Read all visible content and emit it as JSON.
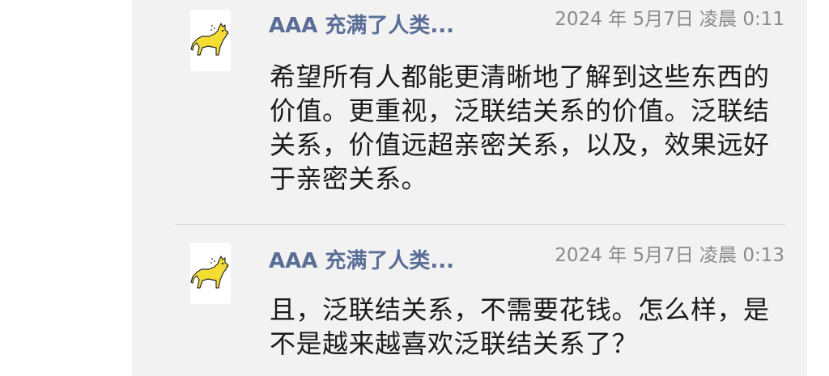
{
  "comments": [
    {
      "author": "AAA 充满了人类...",
      "time": "2024 年 5月7日 凌晨 0:11",
      "text": "希望所有人都能更清晰地了解到这些东西的价值。更重视，泛联结关系的价值。泛联结关系，价值远超亲密关系，以及，效果远好于亲密关系。",
      "avatar_icon": "yellow-cat-icon"
    },
    {
      "author": "AAA 充满了人类...",
      "time": "2024 年 5月7日 凌晨 0:13",
      "text": "且，泛联结关系，不需要花钱。怎么样，是不是越来越喜欢泛联结关系了？",
      "avatar_icon": "yellow-cat-icon"
    }
  ],
  "colors": {
    "author": "#596d96",
    "time": "#8a8a8a",
    "text": "#1a1a1a",
    "feed_background": "#f2f2f2",
    "avatar_cat": "#f3dd33"
  }
}
